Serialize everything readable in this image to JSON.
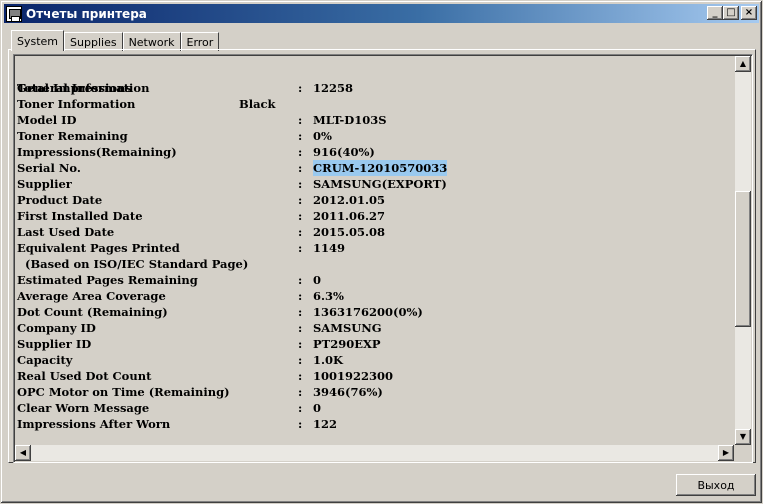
{
  "window": {
    "title": "Отчеты принтера",
    "icon": "printer-icon",
    "controls": {
      "minimize": "_",
      "maximize": "□",
      "close": "×"
    }
  },
  "tabs": [
    {
      "label": "System",
      "active": true
    },
    {
      "label": "Supplies",
      "active": false
    },
    {
      "label": "Network",
      "active": false
    },
    {
      "label": "Error",
      "active": false
    }
  ],
  "report": {
    "header": "General Information",
    "rows": [
      {
        "label": "Total Impressions",
        "sep": ":",
        "value": "12258"
      },
      {
        "label": "Toner Information",
        "extra": "Black"
      },
      {
        "label": "Model ID",
        "sep": ":",
        "value": "MLT-D103S"
      },
      {
        "label": "Toner Remaining",
        "sep": ":",
        "value": "0%"
      },
      {
        "label": "Impressions(Remaining)",
        "sep": ":",
        "value": "916(40%)"
      },
      {
        "label": "Serial No.",
        "sep": ":",
        "value": "CRUM-12010570033",
        "selected": true
      },
      {
        "label": "Supplier",
        "sep": ":",
        "value": "SAMSUNG(EXPORT)"
      },
      {
        "label": "Product Date",
        "sep": ":",
        "value": "2012.01.05"
      },
      {
        "label": "First Installed Date",
        "sep": ":",
        "value": "2011.06.27"
      },
      {
        "label": "Last Used Date",
        "sep": ":",
        "value": "2015.05.08"
      },
      {
        "label": "Equivalent Pages Printed",
        "sep": ":",
        "value": "1149"
      },
      {
        "label": "  (Based on ISO/IEC Standard Page)"
      },
      {
        "label": "Estimated Pages Remaining",
        "sep": ":",
        "value": "0"
      },
      {
        "label": "Average Area Coverage",
        "sep": ":",
        "value": "6.3%"
      },
      {
        "label": "Dot Count (Remaining)",
        "sep": ":",
        "value": "1363176200(0%)"
      },
      {
        "label": "Company ID",
        "sep": ":",
        "value": "SAMSUNG"
      },
      {
        "label": "Supplier ID",
        "sep": ":",
        "value": "PT290EXP"
      },
      {
        "label": "Capacity",
        "sep": ":",
        "value": "1.0K"
      },
      {
        "label": "Real Used Dot Count",
        "sep": ":",
        "value": "1001922300"
      },
      {
        "label": "OPC Motor on Time (Remaining)",
        "sep": ":",
        "value": "3946(76%)"
      },
      {
        "label": "Clear Worn Message",
        "sep": ":",
        "value": "0"
      },
      {
        "label": "Impressions After Worn",
        "sep": ":",
        "value": "122"
      }
    ]
  },
  "scroll": {
    "vertical_position": 0.54,
    "thumb_fraction": 0.38
  },
  "buttons": {
    "exit": "Выход"
  },
  "colors": {
    "selection": "#99c9ef",
    "titlebar_start": "#0a246a",
    "titlebar_end": "#a6caf0"
  }
}
